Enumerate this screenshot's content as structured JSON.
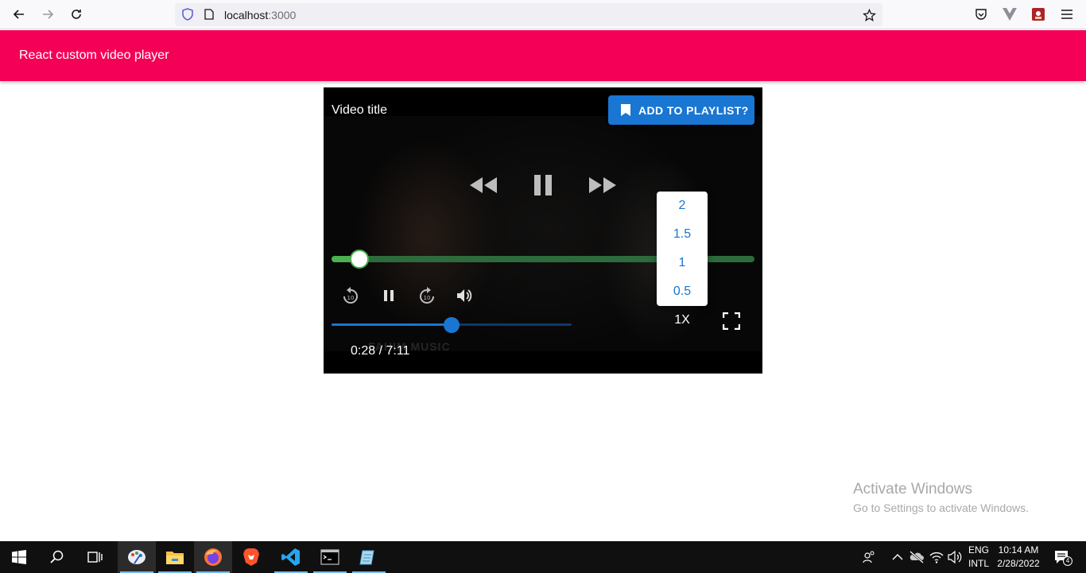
{
  "browser": {
    "url_host": "localhost",
    "url_port": ":3000"
  },
  "app": {
    "title": "React custom video player"
  },
  "player": {
    "video_title": "Video title",
    "playlist_button": "ADD TO PLAYLIST?",
    "progress_percent": 6.6,
    "volume_percent": 50,
    "time": "0:28 / 7:11",
    "watermark": "FAHIM MUSIC",
    "speed_label": "1X",
    "speed_options": [
      "2",
      "1.5",
      "1",
      "0.5"
    ]
  },
  "colors": {
    "appbar": "#f50057",
    "primary": "#1976d2",
    "progress": "#4caf50"
  },
  "windows": {
    "activate_title": "Activate Windows",
    "activate_subtitle": "Go to Settings to activate Windows."
  },
  "taskbar": {
    "apps": [
      "start-icon",
      "search-icon",
      "task-view-icon",
      "paint-icon",
      "file-explorer-icon",
      "firefox-icon",
      "brave-icon",
      "vscode-icon",
      "terminal-icon",
      "notepad-icon"
    ],
    "language": "ENG",
    "layout": "INTL",
    "time": "10:14 AM",
    "date": "2/28/2022",
    "notifications": "4"
  }
}
